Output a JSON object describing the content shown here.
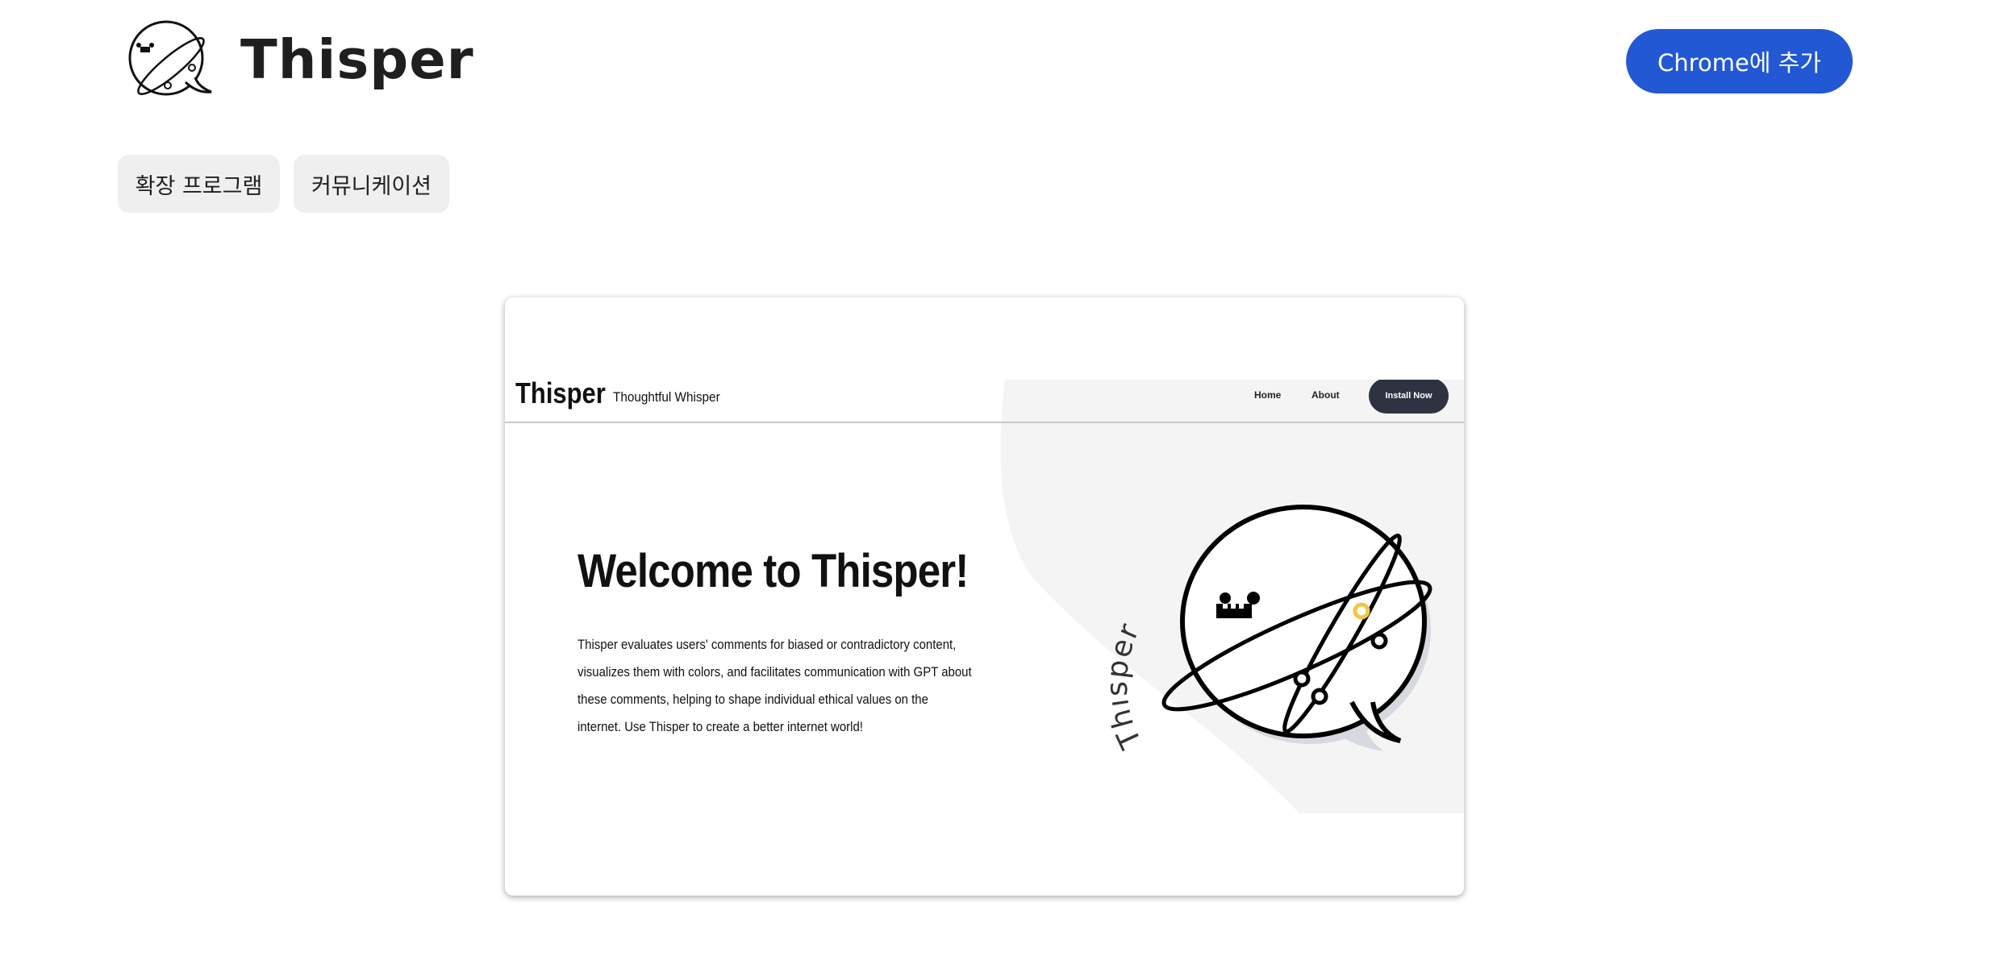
{
  "header": {
    "title": "Thisper",
    "add_button": "Chrome에 추가",
    "logo_icon": "speech-bubble-mascot-icon"
  },
  "categories": [
    {
      "label": "확장 프로그램"
    },
    {
      "label": "커뮤니케이션"
    }
  ],
  "preview": {
    "site_name": "Thisper",
    "tagline": "Thoughtful Whisper",
    "nav": {
      "home": "Home",
      "about": "About",
      "install": "Install Now"
    },
    "heading": "Welcome to Thisper!",
    "description": "Thisper evaluates users' comments for biased or contradictory content, visualizes them with colors, and facilitates communication with GPT about these comments, helping to shape individual ethical values on the internet. Use Thisper to create a better internet world!",
    "mascot_arc_text": "Thisper"
  },
  "colors": {
    "accent": "#2258d3",
    "chip_bg": "#efefef",
    "install_bg": "#2f3341",
    "highlight": "#f2c744"
  }
}
